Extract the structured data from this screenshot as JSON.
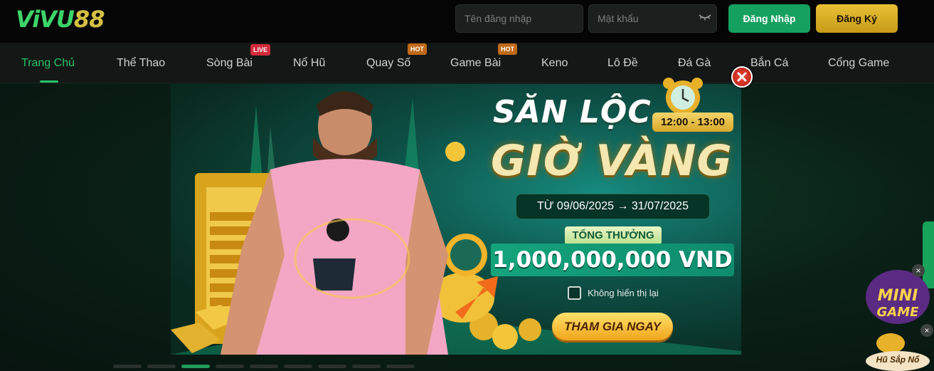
{
  "brand": {
    "logo_part1": "ViVU",
    "logo_part2": "88"
  },
  "auth": {
    "username_placeholder": "Tên đăng nhập",
    "password_placeholder": "Mật khẩu",
    "login_label": "Đăng Nhập",
    "register_label": "Đăng Ký"
  },
  "nav": {
    "items": [
      {
        "label": "Trang Chủ",
        "active": true
      },
      {
        "label": "Thể Thao"
      },
      {
        "label": "Sòng Bài",
        "badge": "LIVE"
      },
      {
        "label": "Nổ Hũ"
      },
      {
        "label": "Quay Số",
        "badge": "HOT"
      },
      {
        "label": "Game Bài",
        "badge": "HOT"
      },
      {
        "label": "Keno"
      },
      {
        "label": "Lô Đề"
      },
      {
        "label": "Đá Gà"
      },
      {
        "label": "Bắn Cá"
      },
      {
        "label": "Cổng Game"
      }
    ]
  },
  "promo": {
    "title_line1": "SĂN LỘC",
    "title_line2": "GIỜ VÀNG",
    "time_range": "12:00 - 13:00",
    "date_range": "TỪ 09/06/2025 → 31/07/2025",
    "prize_label": "TỔNG THƯỞNG",
    "prize_amount": "1,000,000,000 VND",
    "dont_show_label": "Không hiển thị lại",
    "cta_label": "THAM GIA NGAY"
  },
  "carousel": {
    "count": 9,
    "active_index": 2
  },
  "mini_game": {
    "title_line1": "MINI",
    "title_line2": "GAME",
    "jackpot_label": "Hũ Sắp Nổ"
  },
  "colors": {
    "accent_green": "#27c46a",
    "gold": "#e8c035",
    "live_red": "#d22b3c",
    "hot_orange": "#c06a17"
  }
}
